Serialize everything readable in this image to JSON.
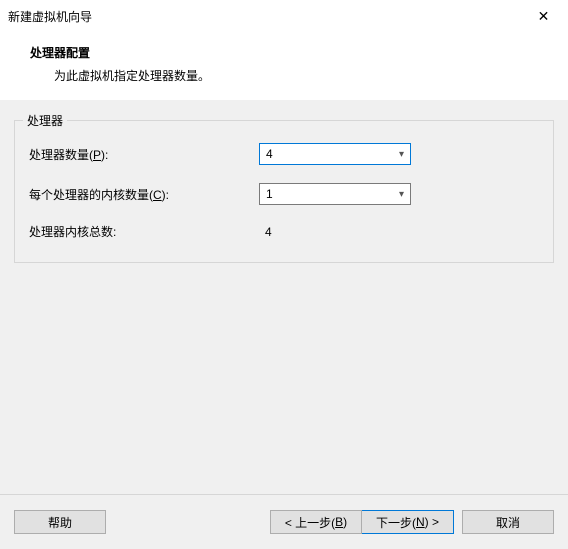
{
  "window": {
    "title": "新建虚拟机向导",
    "close_icon": "✕"
  },
  "header": {
    "heading": "处理器配置",
    "subheading": "为此虚拟机指定处理器数量。"
  },
  "group": {
    "legend": "处理器",
    "rows": {
      "processors": {
        "label_pre": "处理器数量(",
        "hotkey": "P",
        "label_post": "):",
        "value": "4"
      },
      "cores": {
        "label_pre": "每个处理器的内核数量(",
        "hotkey": "C",
        "label_post": "):",
        "value": "1"
      },
      "total": {
        "label": "处理器内核总数:",
        "value": "4"
      }
    }
  },
  "footer": {
    "help": "帮助",
    "back_pre": "< 上一步(",
    "back_hotkey": "B",
    "back_post": ")",
    "next_pre": "下一步(",
    "next_hotkey": "N",
    "next_post": ") >",
    "cancel": "取消"
  }
}
